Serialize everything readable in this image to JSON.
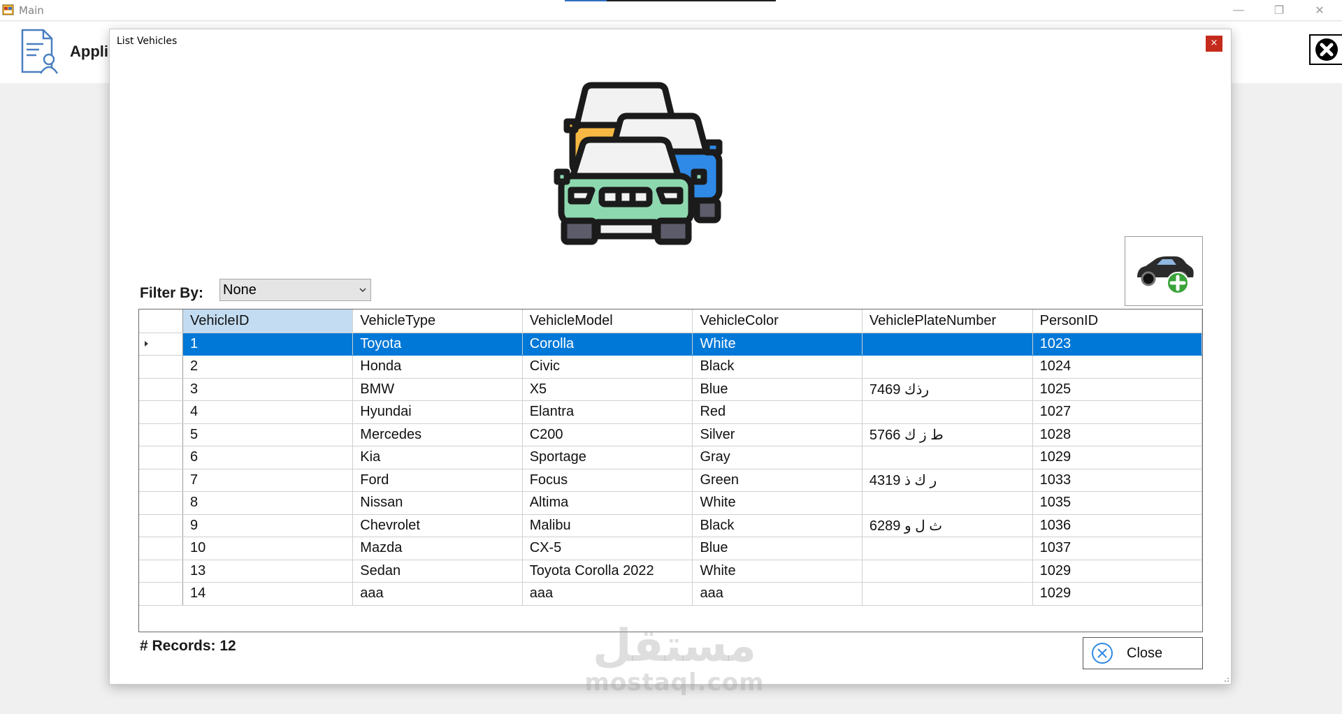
{
  "main_window": {
    "title": "Main",
    "app_button_label": "Appli",
    "controls": {
      "minimize": "—",
      "restore": "❐",
      "close": "✕"
    }
  },
  "dialog": {
    "title": "List Vehicles",
    "close_glyph": "×",
    "filter": {
      "label": "Filter By:",
      "selected": "None"
    },
    "grid": {
      "columns": [
        "VehicleID",
        "VehicleType",
        "VehicleModel",
        "VehicleColor",
        "VehiclePlateNumber",
        "PersonID"
      ],
      "selected_row": 0,
      "rows": [
        [
          "1",
          "Toyota",
          "Corolla",
          "White",
          "",
          "1023"
        ],
        [
          "2",
          "Honda",
          "Civic",
          "Black",
          "",
          "1024"
        ],
        [
          "3",
          "BMW",
          "X5",
          "Blue",
          "7469 رذك",
          "1025"
        ],
        [
          "4",
          "Hyundai",
          "Elantra",
          "Red",
          "",
          "1027"
        ],
        [
          "5",
          "Mercedes",
          "C200",
          "Silver",
          "5766 ط ز ك",
          "1028"
        ],
        [
          "6",
          "Kia",
          "Sportage",
          "Gray",
          "",
          "1029"
        ],
        [
          "7",
          "Ford",
          "Focus",
          "Green",
          "4319 ر ك ذ",
          "1033"
        ],
        [
          "8",
          "Nissan",
          "Altima",
          "White",
          "",
          "1035"
        ],
        [
          "9",
          "Chevrolet",
          "Malibu",
          "Black",
          "6289 ث ل و",
          "1036"
        ],
        [
          "10",
          "Mazda",
          "CX-5",
          "Blue",
          "",
          "1037"
        ],
        [
          "13",
          "Sedan",
          "Toyota Corolla 2022",
          "White",
          "",
          "1029"
        ],
        [
          "14",
          "aaa",
          "aaa",
          "aaa",
          "",
          "1029"
        ]
      ]
    },
    "records_label": "# Records: 12",
    "close_button_label": "Close"
  },
  "watermark": {
    "arabic": "مستقل",
    "latin": "mostaql.com"
  },
  "colors": {
    "selection": "#0078d7",
    "header_selected": "#c3dcf1",
    "title_close": "#c42b1c"
  }
}
